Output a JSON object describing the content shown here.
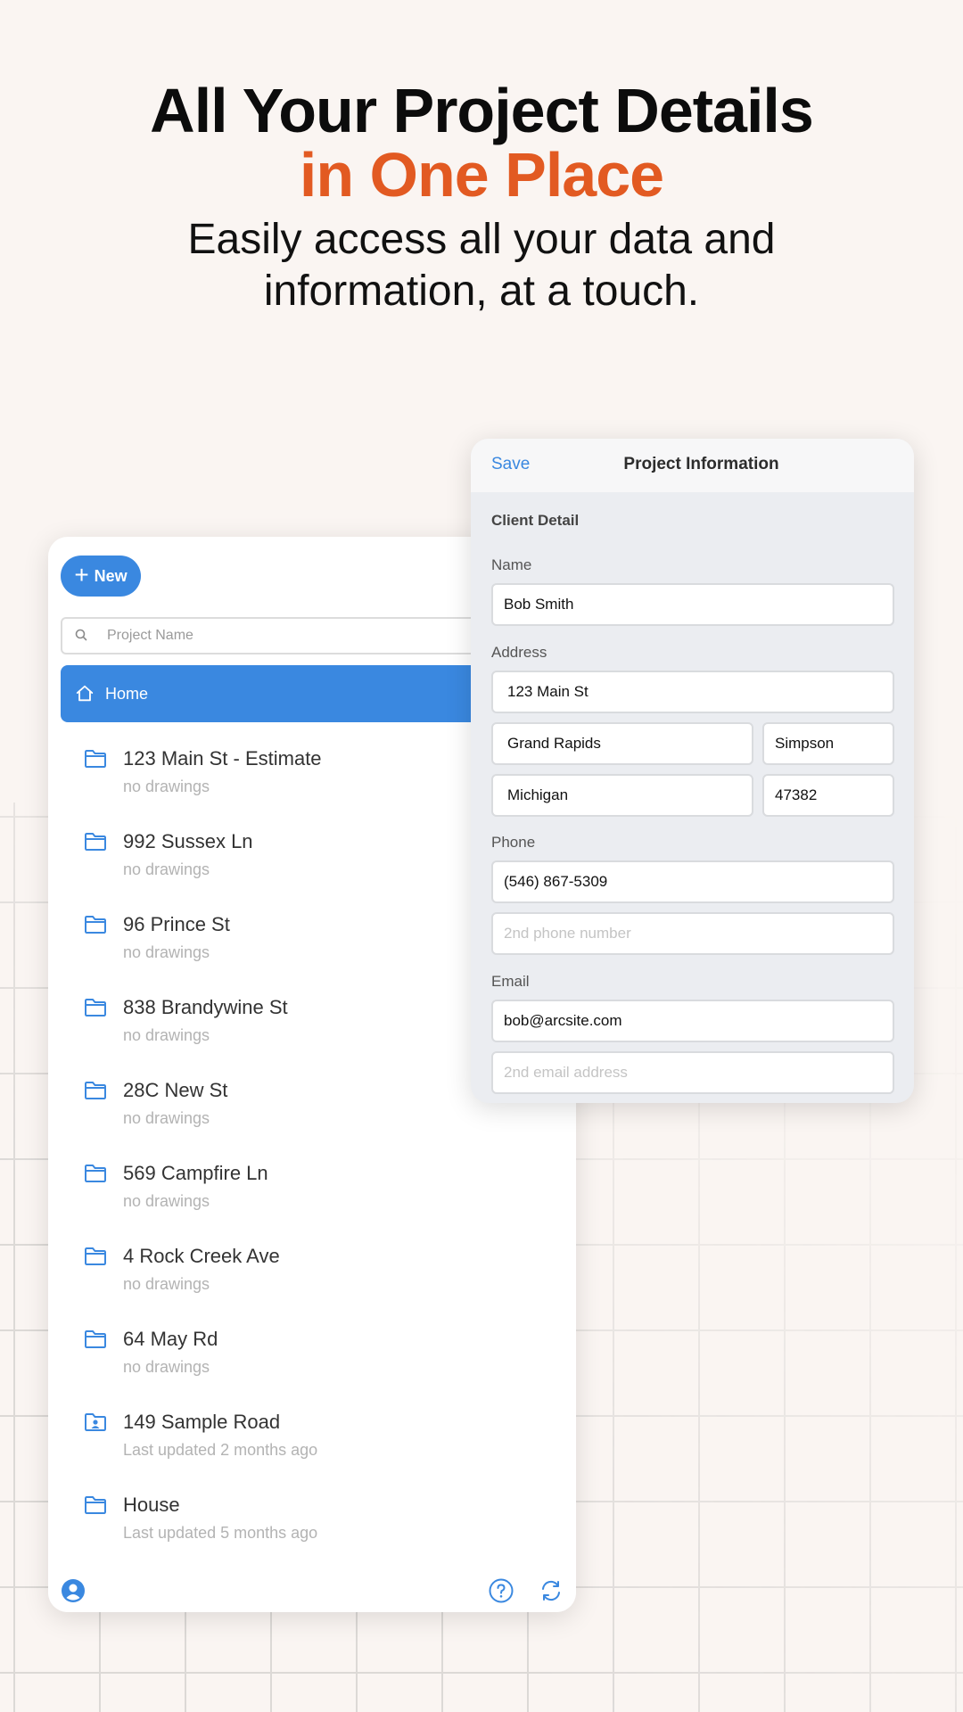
{
  "hero": {
    "line1": "All Your Project Details",
    "line2": "in One Place",
    "sub1": "Easily access all your data and",
    "sub2": "information, at a touch."
  },
  "projects_panel": {
    "new_label": "New",
    "search_placeholder": "Project Name",
    "home_label": "Home",
    "items": [
      {
        "name": "123 Main St - Estimate",
        "sub": "no drawings",
        "icon": "folder-icon"
      },
      {
        "name": "992 Sussex Ln",
        "sub": "no drawings",
        "icon": "folder-icon"
      },
      {
        "name": "96 Prince St",
        "sub": "no drawings",
        "icon": "folder-icon"
      },
      {
        "name": "838 Brandywine St",
        "sub": "no drawings",
        "icon": "folder-icon"
      },
      {
        "name": "28C New St",
        "sub": "no drawings",
        "icon": "folder-icon"
      },
      {
        "name": "569 Campfire Ln",
        "sub": "no drawings",
        "icon": "folder-icon"
      },
      {
        "name": "4 Rock Creek Ave",
        "sub": "no drawings",
        "icon": "folder-icon"
      },
      {
        "name": "64 May Rd",
        "sub": "no drawings",
        "icon": "folder-icon"
      },
      {
        "name": "149 Sample Road",
        "sub": "Last updated 2 months ago",
        "icon": "shared-folder-icon"
      },
      {
        "name": "House",
        "sub": "Last updated 5 months ago",
        "icon": "folder-icon"
      }
    ]
  },
  "project_info": {
    "save_label": "Save",
    "title": "Project Information",
    "section": "Client Detail",
    "name_label": "Name",
    "name_value": "Bob Smith",
    "address_label": "Address",
    "street": "123 Main St",
    "city": "Grand Rapids",
    "county": "Simpson",
    "state": "Michigan",
    "zip": "47382",
    "phone_label": "Phone",
    "phone": "(546) 867-5309",
    "phone2_placeholder": "2nd phone number",
    "email_label": "Email",
    "email": "bob@arcsite.com",
    "email2_placeholder": "2nd email address"
  },
  "colors": {
    "accent": "#e25a22",
    "primary": "#3a88e0",
    "background": "#faf5f2"
  }
}
